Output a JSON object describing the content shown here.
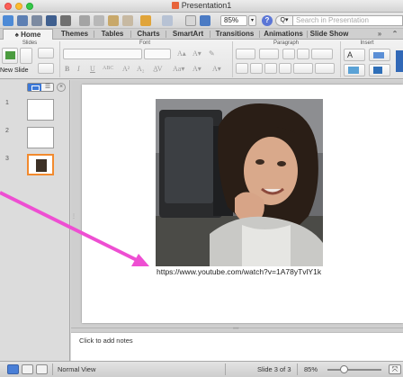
{
  "window": {
    "title": "Presentation1"
  },
  "toolbar": {
    "zoom": "85%",
    "search_placeholder": "Search in Presentation",
    "help_label": "?"
  },
  "tabs": [
    {
      "label": "Home",
      "active": true
    },
    {
      "label": "Themes"
    },
    {
      "label": "Tables"
    },
    {
      "label": "Charts"
    },
    {
      "label": "SmartArt"
    },
    {
      "label": "Transitions"
    },
    {
      "label": "Animations"
    },
    {
      "label": "Slide Show"
    }
  ],
  "ribbon": {
    "groups": [
      "Slides",
      "Font",
      "Paragraph",
      "Insert"
    ],
    "new_slide": "New Slide",
    "font_buttons": [
      "B",
      "I",
      "U",
      "ABC",
      "A²",
      "A₂"
    ]
  },
  "slides_pane": {
    "numbers": [
      "1",
      "2",
      "3"
    ]
  },
  "slide": {
    "link": "https://www.youtube.com/watch?v=1A78yTvlY1k"
  },
  "notes": {
    "placeholder": "Click to add notes"
  },
  "status": {
    "view": "Normal View",
    "slide": "Slide 3 of 3",
    "zoom": "85%"
  },
  "colors": {
    "accent": "#3b78d8",
    "selection": "#f28a2e",
    "arrow": "#ee4fd2"
  }
}
